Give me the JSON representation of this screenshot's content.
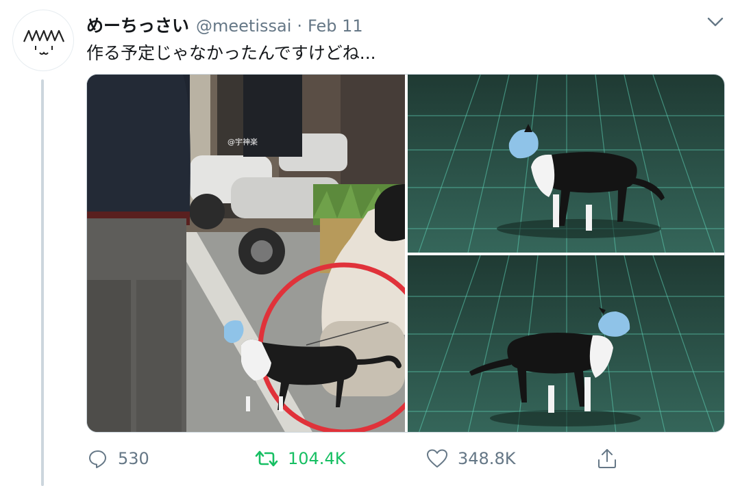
{
  "tweet": {
    "display_name": "めーちっさい",
    "handle": "@meetissai",
    "separator": "·",
    "date": "Feb 11",
    "text": "作る予定じゃなかったんですけどね...",
    "avatar_icon": "hand-drawn-face-icon",
    "menu_icon": "chevron-down-icon"
  },
  "media": {
    "photos": [
      {
        "name": "street-photo",
        "description_icon": "photo",
        "watermark": "@宇神楽"
      },
      {
        "name": "figure-photo-1",
        "description_icon": "photo"
      },
      {
        "name": "figure-photo-2",
        "description_icon": "photo"
      }
    ]
  },
  "actions": {
    "reply": {
      "icon": "reply-icon",
      "count": "530"
    },
    "retweet": {
      "icon": "retweet-icon",
      "count": "104.4K"
    },
    "like": {
      "icon": "heart-icon",
      "count": "348.8K"
    },
    "share": {
      "icon": "share-icon"
    }
  },
  "colors": {
    "text": "#14171a",
    "secondary": "#657786",
    "retweet_green": "#17bf63",
    "thread_line": "#ccd6dd",
    "mask_blue": "#8fc3e8",
    "highlight_red": "#e0323a",
    "cutting_mat": "#2f5a4c"
  }
}
